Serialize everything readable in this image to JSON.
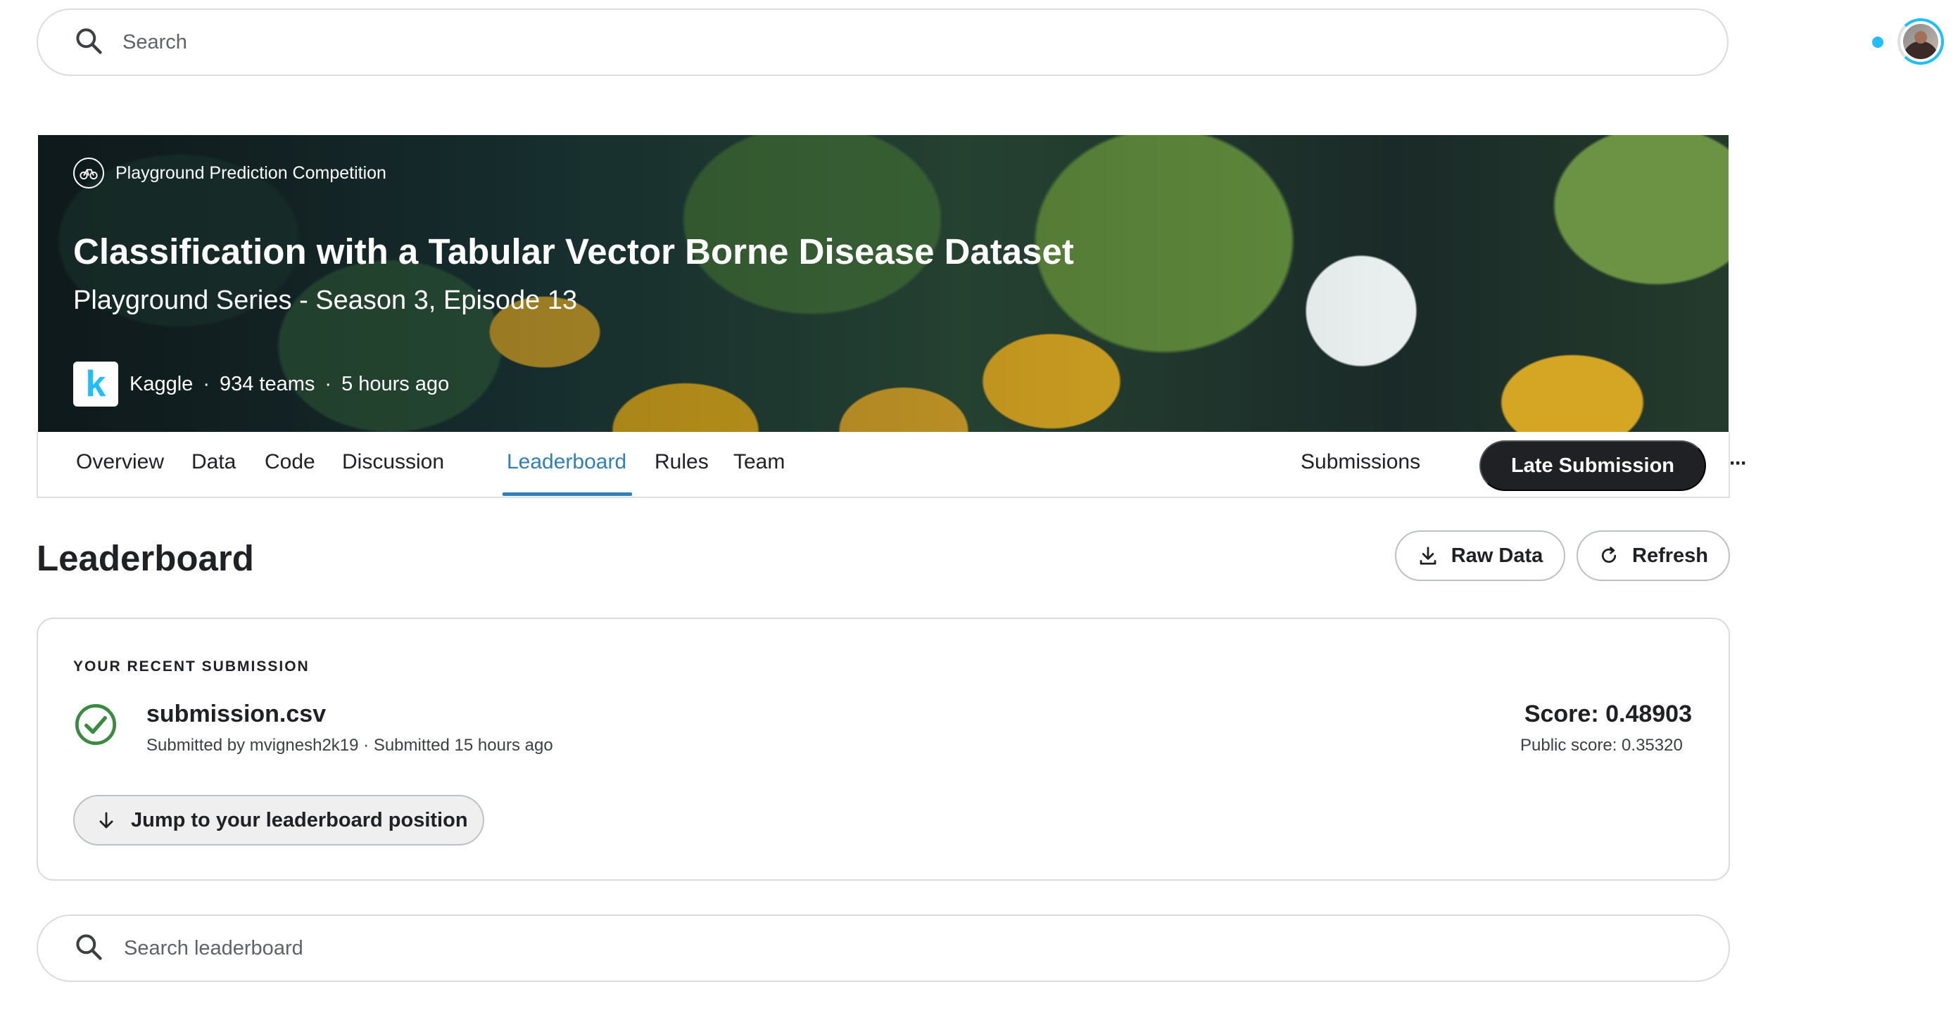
{
  "top_search": {
    "placeholder": "Search"
  },
  "competition": {
    "type": "Playground Prediction Competition",
    "title": "Classification with a Tabular Vector Borne Disease Dataset",
    "subtitle": "Playground Series - Season 3, Episode 13",
    "host_logo_letter": "k",
    "host": "Kaggle",
    "teams": "934 teams",
    "time_ago": "5 hours ago",
    "separator": "·"
  },
  "tabs": [
    {
      "label": "Overview",
      "active": false
    },
    {
      "label": "Data",
      "active": false
    },
    {
      "label": "Code",
      "active": false
    },
    {
      "label": "Discussion",
      "active": false
    },
    {
      "label": "Leaderboard",
      "active": true
    },
    {
      "label": "Rules",
      "active": false
    },
    {
      "label": "Team",
      "active": false
    }
  ],
  "tab_actions": {
    "submissions_label": "Submissions",
    "late_submission_label": "Late Submission",
    "more_label": "···"
  },
  "leaderboard": {
    "heading": "Leaderboard",
    "raw_data_label": "Raw Data",
    "refresh_label": "Refresh"
  },
  "recent_submission": {
    "section_label": "YOUR RECENT SUBMISSION",
    "file_name": "submission.csv",
    "meta": "Submitted by mvignesh2k19 · Submitted 15 hours ago",
    "score": "Score: 0.48903",
    "public_score": "Public score: 0.35320",
    "jump_label": "Jump to your leaderboard position"
  },
  "leaderboard_search": {
    "placeholder": "Search leaderboard"
  },
  "colors": {
    "accent": "#2f7fb8",
    "success": "#3a8a3f",
    "dark_button": "#202124",
    "notification": "#20beff"
  },
  "icons": [
    "search-icon",
    "competition-badge-icon",
    "kaggle-logo",
    "download-icon",
    "refresh-icon",
    "check-circle-icon",
    "arrow-down-icon",
    "more-icon"
  ]
}
